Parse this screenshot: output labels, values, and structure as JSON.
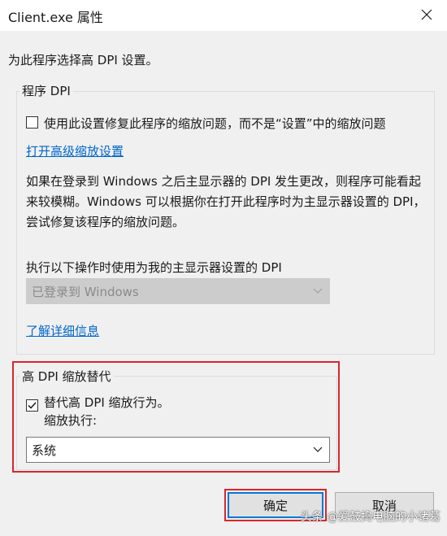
{
  "window": {
    "title": "Client.exe 属性",
    "close_icon": "close-icon"
  },
  "intro_text": "为此程序选择高 DPI 设置。",
  "program_dpi": {
    "group_label": "程序 DPI",
    "checkbox_label": "使用此设置修复此程序的缩放问题，而不是“设置”中的缩放问题",
    "checkbox_checked": false,
    "advanced_link": "打开高级缩放设置",
    "description": "如果在登录到 Windows 之后主显示器的 DPI 发生更改，则程序可能看起来较模糊。Windows 可以根据你在打开此程序时为主显示器设置的 DPI，尝试修复该程序的缩放问题。",
    "dropdown_label": "执行以下操作时使用为我的主显示器设置的 DPI",
    "dropdown_value": "已登录到 Windows",
    "learn_more_link": "了解详细信息"
  },
  "high_dpi_override": {
    "group_label": "高 DPI 缩放替代",
    "checkbox_label": "替代高 DPI 缩放行为。",
    "checkbox_sublabel": "缩放执行:",
    "checkbox_checked": true,
    "dropdown_value": "系统"
  },
  "buttons": {
    "ok_label": "确定",
    "cancel_label": "取消"
  },
  "watermark": "头条 @爱鼓捣电脑的小诸葛",
  "colors": {
    "highlight_red": "#d9262b",
    "link_blue": "#0066cc",
    "focus_blue": "#0078d7"
  }
}
